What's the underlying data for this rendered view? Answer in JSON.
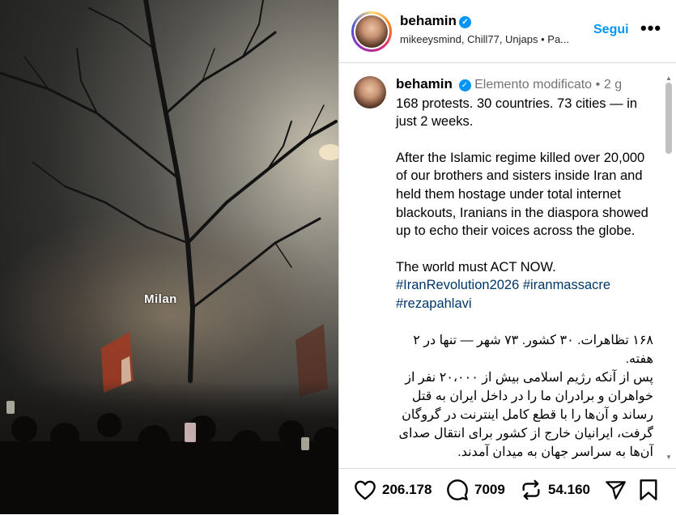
{
  "media": {
    "overlay_label": "Milan"
  },
  "header": {
    "username": "behamin",
    "subtitle": "mikeeysmind, Chill77, Unjaps • Pa...",
    "follow_label": "Segui",
    "more_label": "•••"
  },
  "comment": {
    "username": "behamin",
    "edited_label": "Elemento modificato",
    "separator": "•",
    "time": "2 g",
    "p1": "168 protests. 30 countries. 73 cities — in just 2 weeks.",
    "p2": "After the Islamic regime killed over 20,000 of our brothers and sisters inside Iran and held them hostage under total internet blackouts, Iranians in the diaspora showed up to echo their voices across the globe.",
    "p3": "The world must ACT NOW.",
    "tags": [
      "#IranRevolution2026",
      "#iranmassacre",
      "#rezapahlavi"
    ],
    "fa1": "۱۶۸ تظاهرات. ۳۰ کشور. ۷۳ شهر — تنها در ۲ هفته.",
    "fa2": "پس از آنکه رژیم اسلامی بیش از ۲۰،۰۰۰ نفر از خواهران و برادران ما را در داخل ایران به قتل رساند و آن‌ها را با قطع کامل اینترنت در گروگان گرفت، ایرانیان خارج از کشور برای انتقال صدای آن‌ها به سراسر جهان به میدان آمدند."
  },
  "actions": {
    "likes": "206.178",
    "comments": "7009",
    "reposts": "54.160"
  },
  "icons": [
    "verified-badge",
    "heart-icon",
    "comment-icon",
    "repost-icon",
    "share-icon",
    "bookmark-icon"
  ],
  "colors": {
    "accent": "#0095f6",
    "hashtag": "#00376b",
    "muted": "#737373"
  }
}
